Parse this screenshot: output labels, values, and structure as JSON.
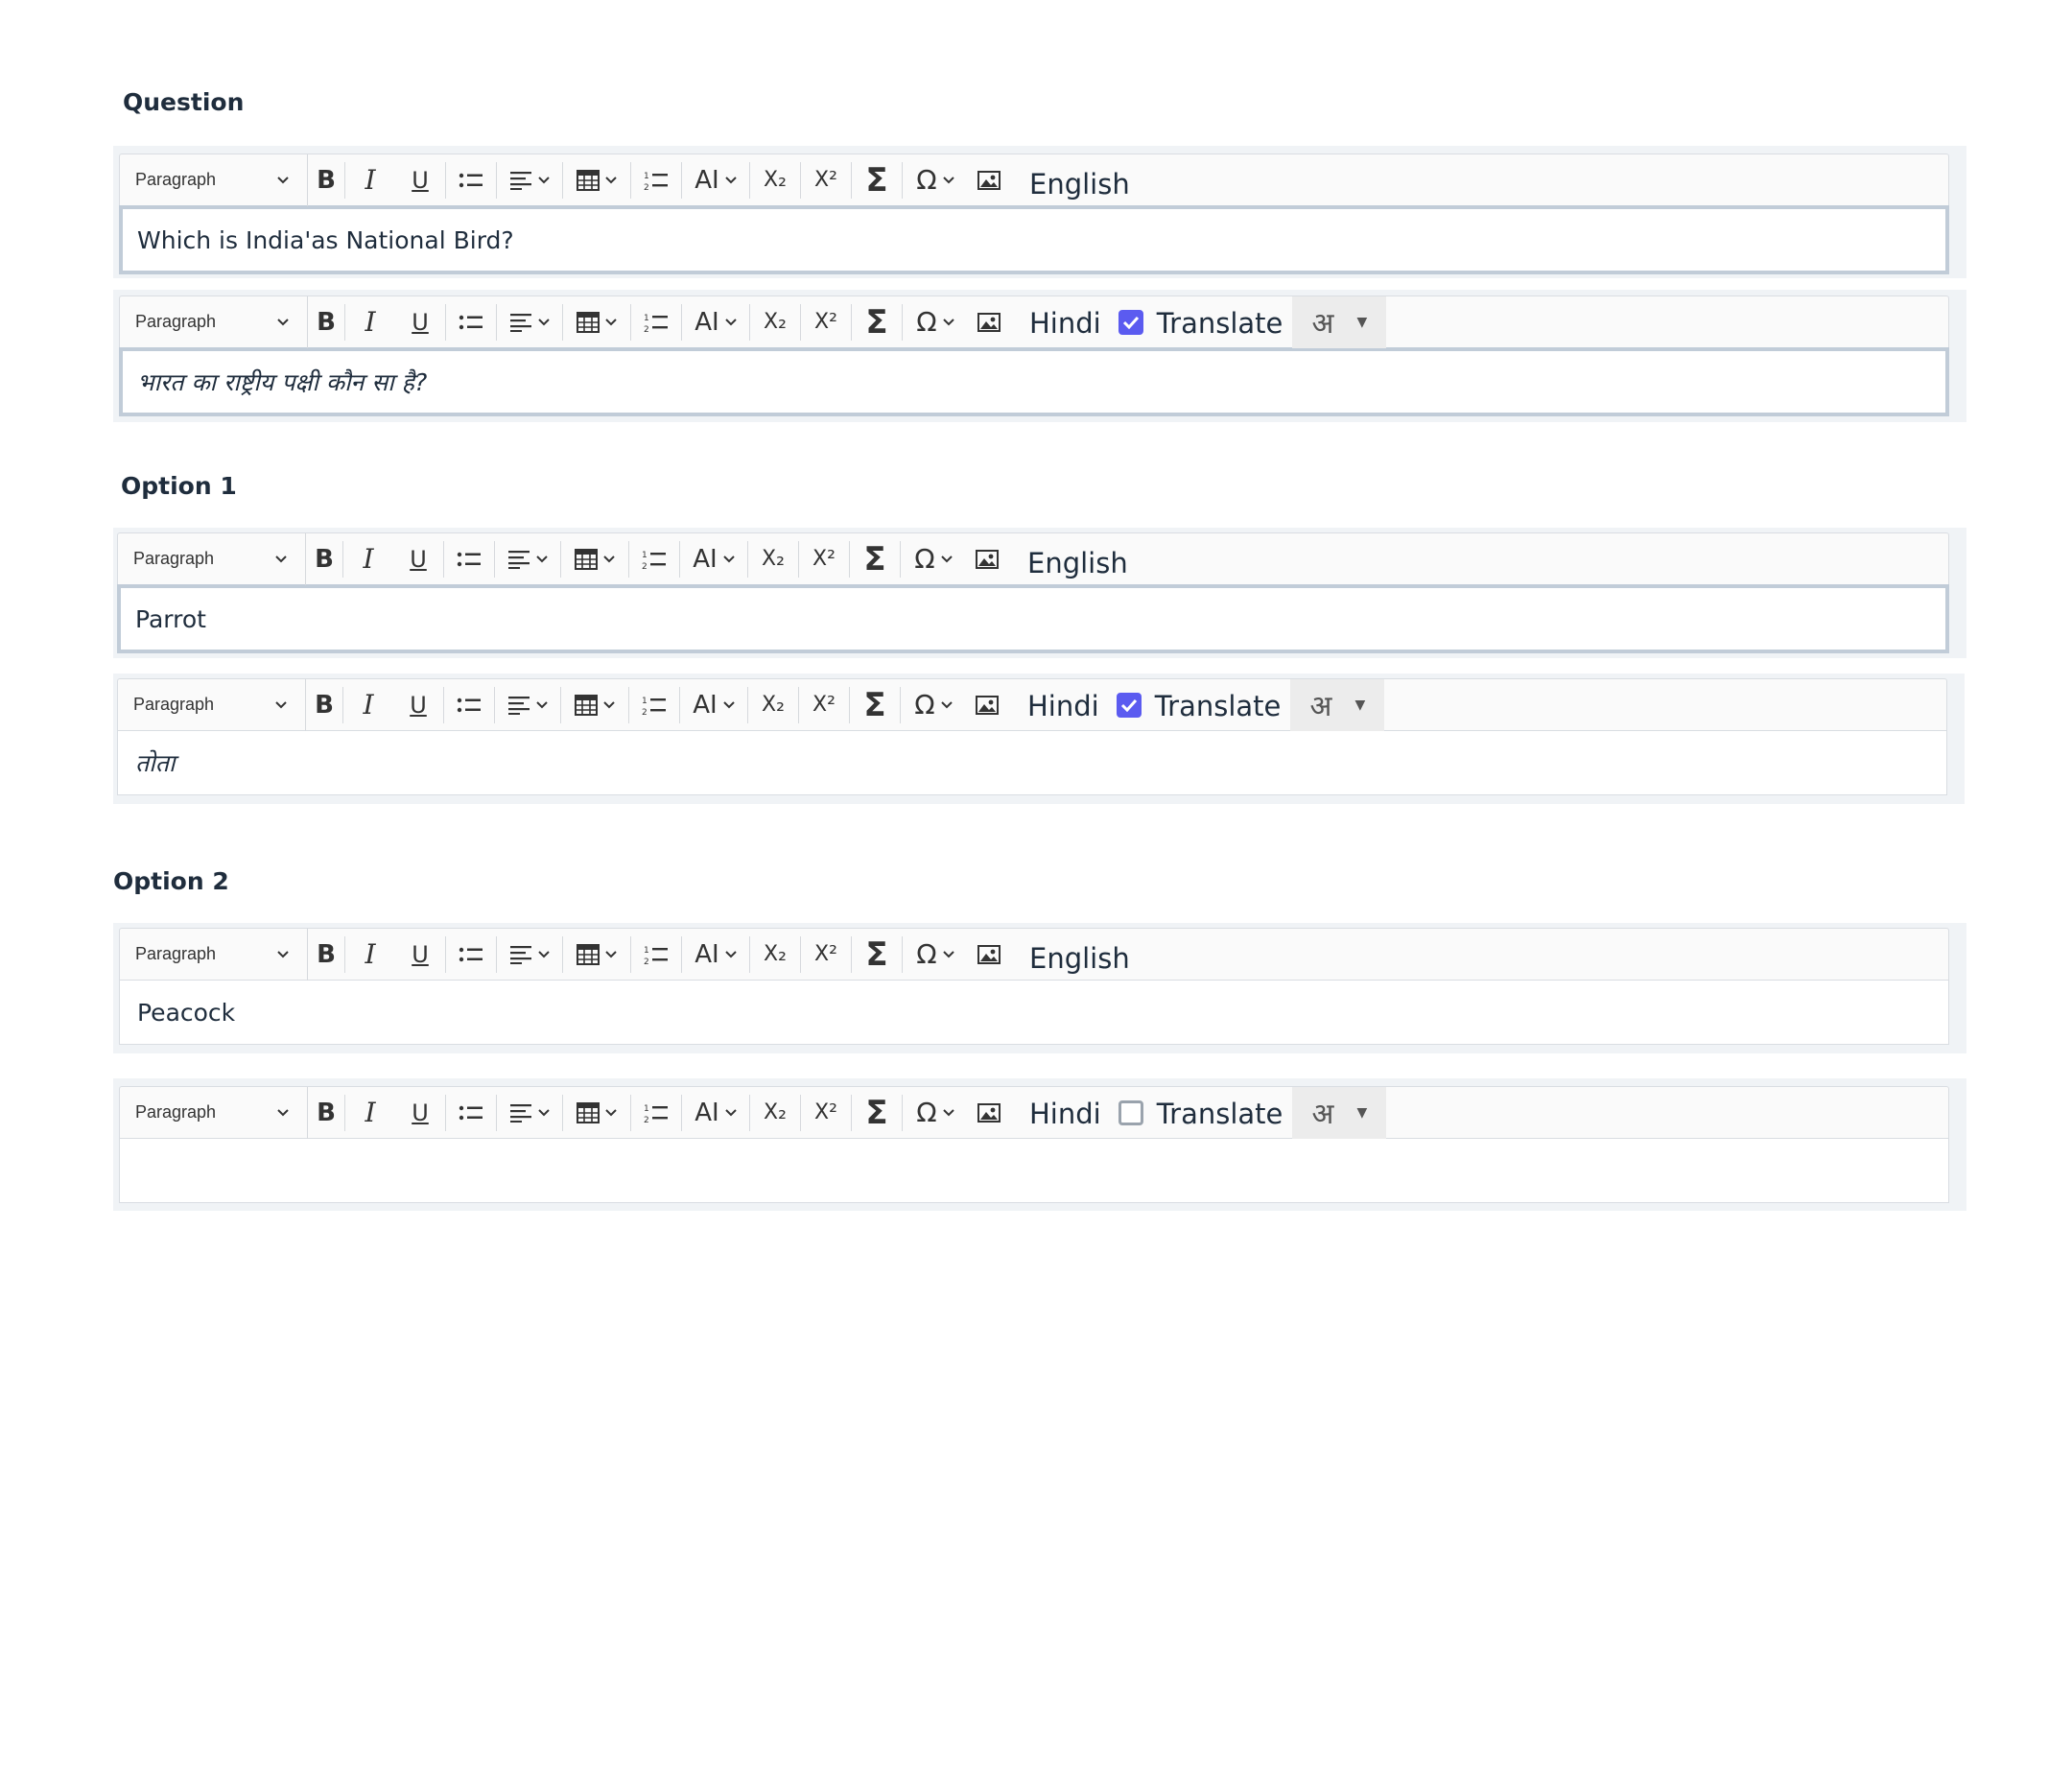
{
  "sections": {
    "question": {
      "label": "Question",
      "english": {
        "lang": "English",
        "text": "Which is India'as National Bird?"
      },
      "hindi": {
        "lang": "Hindi",
        "translate_label": "Translate",
        "translate_checked": true,
        "script": "अ",
        "text": "भारत का राष्ट्रीय पक्षी कौन सा है?"
      }
    },
    "option1": {
      "label": "Option 1",
      "english": {
        "lang": "English",
        "text": "Parrot"
      },
      "hindi": {
        "lang": "Hindi",
        "translate_label": "Translate",
        "translate_checked": true,
        "script": "अ",
        "text": "तोता"
      }
    },
    "option2": {
      "label": "Option 2",
      "english": {
        "lang": "English",
        "text": "Peacock"
      },
      "hindi": {
        "lang": "Hindi",
        "translate_label": "Translate",
        "translate_checked": false,
        "script": "अ",
        "text": ""
      }
    }
  },
  "toolbar": {
    "paragraph_label": "Paragraph",
    "bold": "B",
    "italic": "I",
    "underline": "U",
    "font_size": "AI",
    "subscript": "X₂",
    "superscript": "X²",
    "sigma": "Σ",
    "omega": "Ω"
  },
  "colors": {
    "accent": "#5b5bf0",
    "group_bg": "#f0f3f6",
    "text": "#1f2d3d"
  }
}
